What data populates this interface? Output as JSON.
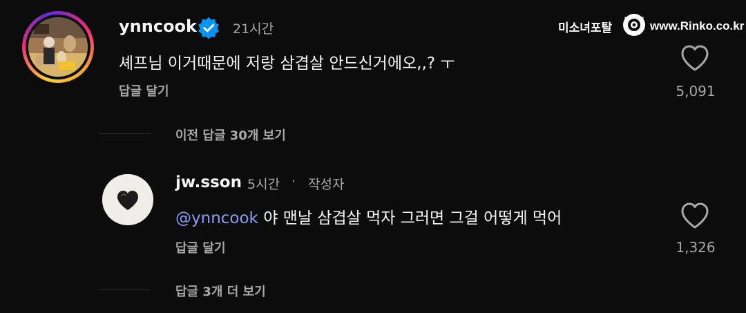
{
  "watermark": {
    "left_text": "미소녀포탈",
    "right_text": "www.Rinko.co.kr"
  },
  "comments": [
    {
      "username": "ynncook",
      "verified": true,
      "timestamp": "21시간",
      "text": "셰프님 이거때문에 저랑 삼겹살 안드신거에오,,? ㅜ",
      "reply_label": "답글 달기",
      "likes": "5,091",
      "avatar": "profile-photo-with-dogs"
    },
    {
      "username": "jw.sson",
      "timestamp": "5시간",
      "separator": "·",
      "author_badge": "작성자",
      "mention": "@ynncook",
      "text": "야 맨날 삼겹살 먹자 그러면 그걸 어떻게 먹어",
      "reply_label": "답글 달기",
      "likes": "1,326",
      "avatar": "black-heart-on-white"
    }
  ],
  "view_previous_replies": "이전 답글 30개 보기",
  "view_more_replies": "답글 3개 더 보기",
  "colors": {
    "background": "#0c0c0d",
    "text_primary": "#f5f5f5",
    "text_secondary": "#a8a8a8",
    "mention": "#8c9cf5",
    "verified": "#0095f6"
  }
}
